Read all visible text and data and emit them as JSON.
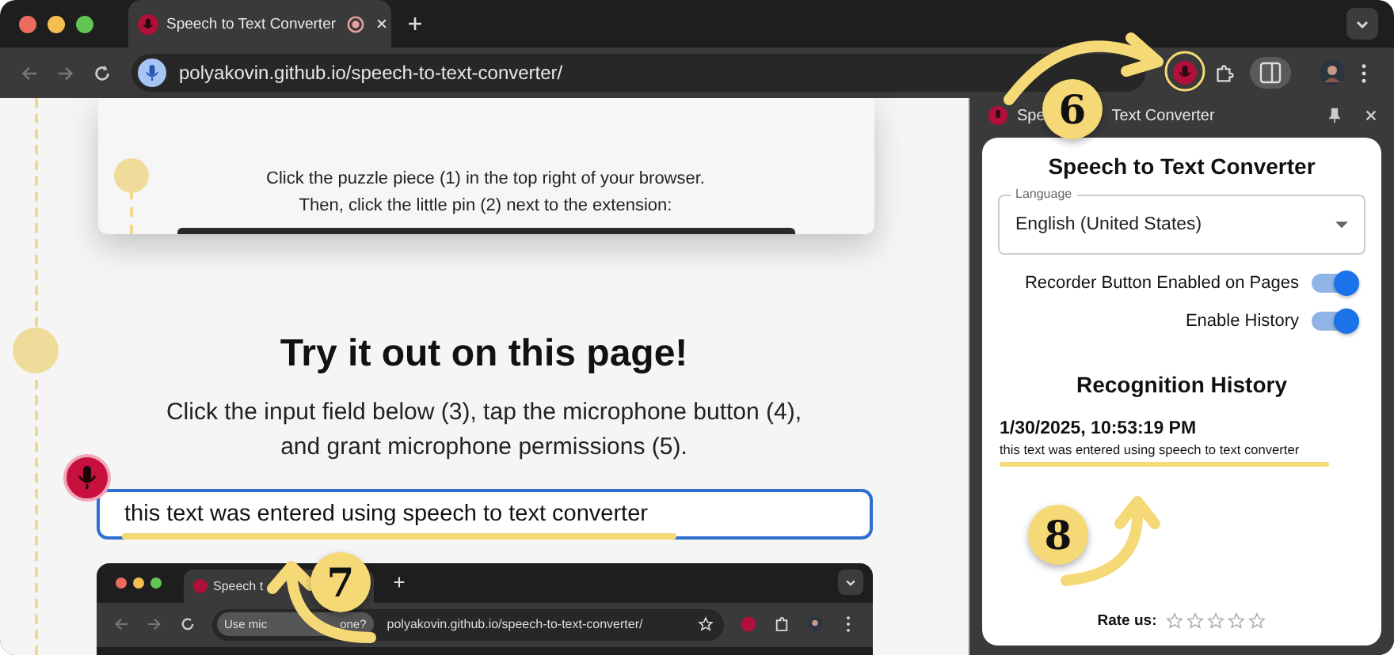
{
  "browser": {
    "tab_title": "Speech to Text Converter",
    "url": "polyakovin.github.io/speech-to-text-converter/"
  },
  "page": {
    "step_text": [
      "Click the puzzle piece (1) in the top right of your browser.",
      "Then, click the little pin (2) next to the extension:"
    ],
    "heading": "Try it out on this page!",
    "instructions": [
      "Click the input field below (3), tap the microphone button (4),",
      "and grant microphone permissions (5)."
    ],
    "input_value": "this text was entered using speech to text converter",
    "embedded_browser": {
      "tab_title": "Speech t",
      "permission_chip": [
        "Use mic",
        "one?"
      ],
      "url": "polyakovin.github.io/speech-to-text-converter/"
    }
  },
  "side_panel": {
    "title_parts": [
      "Spe",
      "Text Converter"
    ],
    "popup": {
      "title": "Speech to Text Converter",
      "language": {
        "label": "Language",
        "value": "English (United States)"
      },
      "settings": [
        {
          "label": "Recorder Button Enabled on Pages",
          "on": true
        },
        {
          "label": "Enable History",
          "on": true
        }
      ],
      "history_title": "Recognition History",
      "history": [
        {
          "time": "1/30/2025, 10:53:19 PM",
          "text": "this text was entered using speech to text converter"
        }
      ],
      "rating": {
        "label": "Rate us:",
        "stars": 0
      }
    }
  },
  "annotations": [
    {
      "number": "6"
    },
    {
      "number": "7"
    },
    {
      "number": "8"
    }
  ]
}
